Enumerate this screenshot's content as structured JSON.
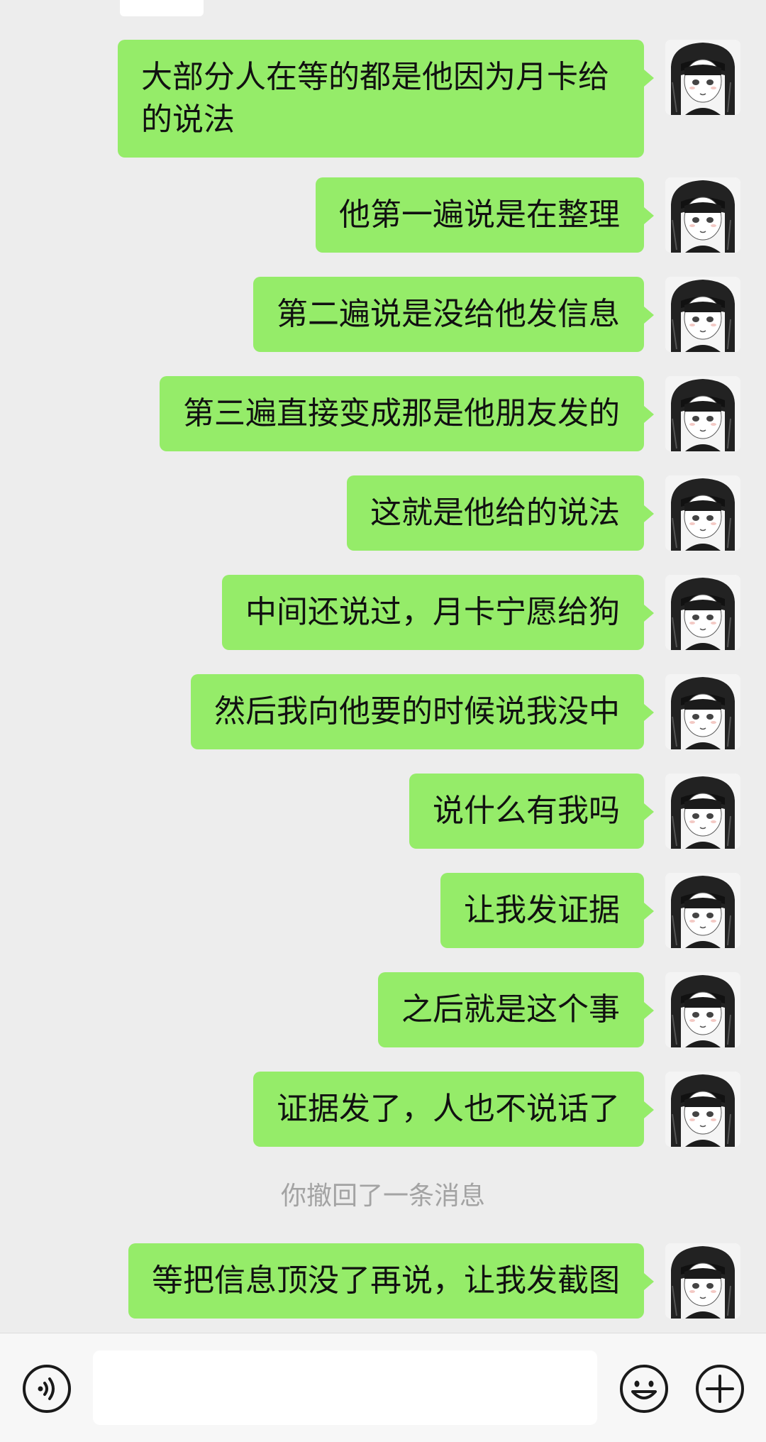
{
  "messages": [
    {
      "text": "大部分人在等的都是他因为月卡给的说法"
    },
    {
      "text": "他第一遍说是在整理"
    },
    {
      "text": "第二遍说是没给他发信息"
    },
    {
      "text": "第三遍直接变成那是他朋友发的"
    },
    {
      "text": "这就是他给的说法"
    },
    {
      "text": "中间还说过，月卡宁愿给狗"
    },
    {
      "text": "然后我向他要的时候说我没中"
    },
    {
      "text": "说什么有我吗"
    },
    {
      "text": "让我发证据"
    },
    {
      "text": "之后就是这个事"
    },
    {
      "text": "证据发了，人也不说话了"
    },
    {
      "text": "等把信息顶没了再说，让我发截图"
    }
  ],
  "recall_notice": "你撤回了一条消息",
  "input_bar": {
    "input_value": "",
    "voice_icon": "voice-icon",
    "emoji_icon": "emoji-icon",
    "plus_icon": "plus-icon"
  },
  "colors": {
    "background": "#ededed",
    "bubble": "#95ec69",
    "recall_text": "#a3a3a3"
  }
}
